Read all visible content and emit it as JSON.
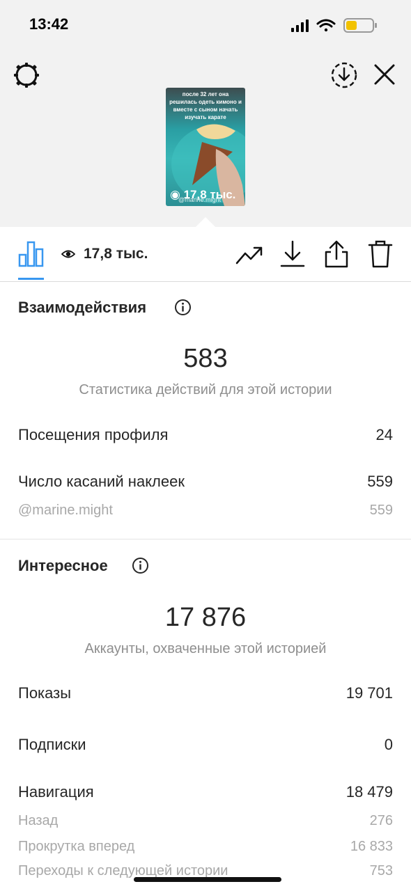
{
  "status_bar": {
    "time": "13:42"
  },
  "preview": {
    "caption": "после 32 лет она решилась одеть кимоно и вместе с сыном начать изучать карате",
    "views": "17,8 тыс.",
    "tag": "@marine.might"
  },
  "toolbar": {
    "views": "17,8 тыс."
  },
  "interactions": {
    "title": "Взаимодействия",
    "total": "583",
    "caption": "Статистика действий для этой истории",
    "rows": [
      {
        "label": "Посещения профиля",
        "value": "24"
      },
      {
        "label": "Число касаний наклеек",
        "value": "559"
      }
    ],
    "sub_rows": [
      {
        "label": "@marine.might",
        "value": "559"
      }
    ]
  },
  "discovery": {
    "title": "Интересное",
    "total": "17 876",
    "caption": "Аккаунты, охваченные этой историей",
    "rows": [
      {
        "label": "Показы",
        "value": "19 701"
      },
      {
        "label": "Подписки",
        "value": "0"
      },
      {
        "label": "Навигация",
        "value": "18 479"
      }
    ],
    "sub_rows": [
      {
        "label": "Назад",
        "value": "276"
      },
      {
        "label": "Прокрутка вперед",
        "value": "16 833"
      },
      {
        "label": "Переходы к следующей истории",
        "value": "753"
      }
    ]
  },
  "colors": {
    "accent": "#3897f0",
    "text": "#262626",
    "muted": "#8e8e8e"
  }
}
